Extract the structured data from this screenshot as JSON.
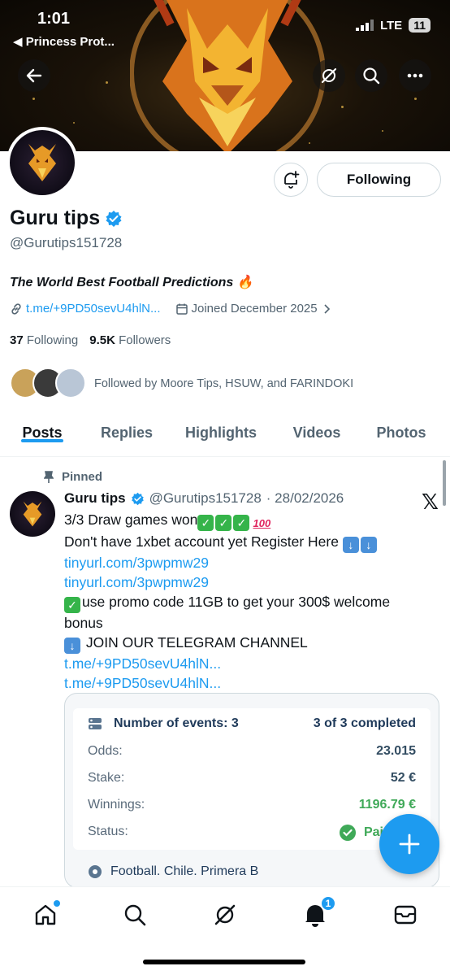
{
  "status_bar": {
    "time": "1:01",
    "back_app": "◀ Princess Prot...",
    "network": "LTE",
    "battery": "11"
  },
  "profile": {
    "name": "Guru tips",
    "handle": "@Gurutips151728",
    "bio": "The World Best Football Predictions",
    "bio_emoji": "🔥",
    "link": "t.me/+9PD50sevU4hlN...",
    "joined": "Joined December 2025",
    "following_count": "37",
    "following_label": "Following",
    "followers_count": "9.5K",
    "followers_label": "Followers",
    "followed_by": "Followed by Moore Tips, HSUW, and FARINDOKI",
    "following_button": "Following"
  },
  "tabs": [
    "Posts",
    "Replies",
    "Highlights",
    "Videos",
    "Photos"
  ],
  "post": {
    "pinned_label": "Pinned",
    "name": "Guru tips",
    "handle": "@Gurutips151728",
    "date": "· 28/02/2026",
    "line1": "3/3 Draw games won",
    "line2": "Don't have 1xbet account yet Register Here",
    "link1": "tinyurl.com/3pwpmw29",
    "link2": "tinyurl.com/3pwpmw29",
    "line_promo": "use promo code 11GB to get your 300$ welcome",
    "line_promo2": "bonus",
    "line_join": "JOIN OUR TELEGRAM CHANNEL",
    "link3": "t.me/+9PD50sevU4hlN...",
    "link4": "t.me/+9PD50sevU4hlN..."
  },
  "bet_card": {
    "events_label": "Number of events: 3",
    "completed": "3 of 3 completed",
    "odds_label": "Odds:",
    "odds_value": "23.015",
    "stake_label": "Stake:",
    "stake_value": "52 €",
    "winnings_label": "Winnings:",
    "winnings_value": "1196.79 €",
    "status_label": "Status:",
    "status_value": "Pai",
    "league": "Football. Chile. Primera B"
  },
  "nav": {
    "notifications_badge": "1"
  },
  "colors": {
    "accent": "#1d9bf0",
    "text": "#0f1419",
    "muted": "#536471",
    "win_green": "#3fa958"
  }
}
